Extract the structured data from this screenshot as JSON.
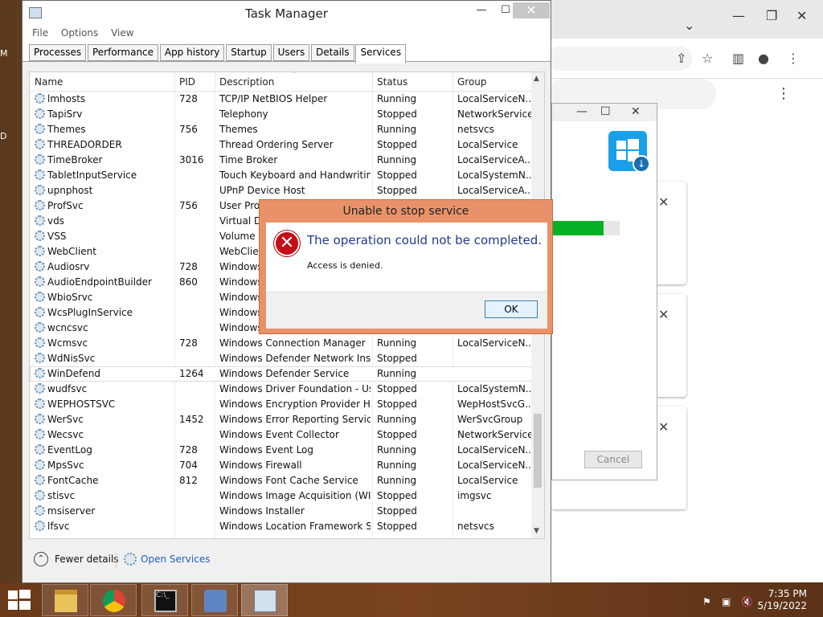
{
  "desktop": {
    "edge_labels": [
      "M",
      "D"
    ]
  },
  "taskmanager": {
    "title": "Task Manager",
    "menu": [
      "File",
      "Options",
      "View"
    ],
    "tabs": [
      "Processes",
      "Performance",
      "App history",
      "Startup",
      "Users",
      "Details",
      "Services"
    ],
    "active_tab": "Services",
    "columns": {
      "name": "Name",
      "pid": "PID",
      "description": "Description",
      "status": "Status",
      "group": "Group"
    },
    "rows": [
      {
        "name": "lmhosts",
        "pid": "728",
        "description": "TCP/IP NetBIOS Helper",
        "status": "Running",
        "group": "LocalServiceN..."
      },
      {
        "name": "TapiSrv",
        "pid": "",
        "description": "Telephony",
        "status": "Stopped",
        "group": "NetworkService"
      },
      {
        "name": "Themes",
        "pid": "756",
        "description": "Themes",
        "status": "Running",
        "group": "netsvcs"
      },
      {
        "name": "THREADORDER",
        "pid": "",
        "description": "Thread Ordering Server",
        "status": "Stopped",
        "group": "LocalService"
      },
      {
        "name": "TimeBroker",
        "pid": "3016",
        "description": "Time Broker",
        "status": "Running",
        "group": "LocalServiceA..."
      },
      {
        "name": "TabletInputService",
        "pid": "",
        "description": "Touch Keyboard and Handwritin...",
        "status": "Stopped",
        "group": "LocalSystemN..."
      },
      {
        "name": "upnphost",
        "pid": "",
        "description": "UPnP Device Host",
        "status": "Stopped",
        "group": "LocalServiceA..."
      },
      {
        "name": "ProfSvc",
        "pid": "756",
        "description": "User Profi",
        "status": "",
        "group": ""
      },
      {
        "name": "vds",
        "pid": "",
        "description": "Virtual Dis",
        "status": "",
        "group": ""
      },
      {
        "name": "VSS",
        "pid": "",
        "description": "Volume Sh",
        "status": "",
        "group": ""
      },
      {
        "name": "WebClient",
        "pid": "",
        "description": "WebClien",
        "status": "",
        "group": ""
      },
      {
        "name": "Audiosrv",
        "pid": "728",
        "description": "Windows",
        "status": "",
        "group": ""
      },
      {
        "name": "AudioEndpointBuilder",
        "pid": "860",
        "description": "Windows",
        "status": "",
        "group": ""
      },
      {
        "name": "WbioSrvc",
        "pid": "",
        "description": "Windows",
        "status": "",
        "group": ""
      },
      {
        "name": "WcsPlugInService",
        "pid": "",
        "description": "Windows",
        "status": "",
        "group": ""
      },
      {
        "name": "wcncsvc",
        "pid": "",
        "description": "Windows",
        "status": "",
        "group": ""
      },
      {
        "name": "Wcmsvc",
        "pid": "728",
        "description": "Windows Connection Manager",
        "status": "Running",
        "group": "LocalServiceN..."
      },
      {
        "name": "WdNisSvc",
        "pid": "",
        "description": "Windows Defender Network Insp...",
        "status": "Stopped",
        "group": ""
      },
      {
        "name": "WinDefend",
        "pid": "1264",
        "description": "Windows Defender Service",
        "status": "Running",
        "group": ""
      },
      {
        "name": "wudfsvc",
        "pid": "",
        "description": "Windows Driver Foundation - Us...",
        "status": "Stopped",
        "group": "LocalSystemN..."
      },
      {
        "name": "WEPHOSTSVC",
        "pid": "",
        "description": "Windows Encryption Provider H...",
        "status": "Stopped",
        "group": "WepHostSvcG..."
      },
      {
        "name": "WerSvc",
        "pid": "1452",
        "description": "Windows Error Reporting Service",
        "status": "Running",
        "group": "WerSvcGroup"
      },
      {
        "name": "Wecsvc",
        "pid": "",
        "description": "Windows Event Collector",
        "status": "Stopped",
        "group": "NetworkService"
      },
      {
        "name": "EventLog",
        "pid": "728",
        "description": "Windows Event Log",
        "status": "Running",
        "group": "LocalServiceN..."
      },
      {
        "name": "MpsSvc",
        "pid": "704",
        "description": "Windows Firewall",
        "status": "Running",
        "group": "LocalServiceN..."
      },
      {
        "name": "FontCache",
        "pid": "812",
        "description": "Windows Font Cache Service",
        "status": "Running",
        "group": "LocalService"
      },
      {
        "name": "stisvc",
        "pid": "",
        "description": "Windows Image Acquisition (WIA)",
        "status": "Stopped",
        "group": "imgsvc"
      },
      {
        "name": "msiserver",
        "pid": "",
        "description": "Windows Installer",
        "status": "Stopped",
        "group": ""
      },
      {
        "name": "lfsvc",
        "pid": "",
        "description": "Windows Location Framework S...",
        "status": "Stopped",
        "group": "netsvcs"
      }
    ],
    "selected_row": "WinDefend",
    "footer": {
      "fewer_details": "Fewer details",
      "open_services": "Open Services"
    }
  },
  "error_dialog": {
    "title": "Unable to stop service",
    "message": "The operation could not be completed.",
    "detail": "Access is denied.",
    "ok_label": "OK"
  },
  "installer": {
    "cancel_label": "Cancel",
    "progress_fraction": 0.76
  },
  "taskbar": {
    "time": "7:35 PM",
    "date": "5/19/2022",
    "apps": [
      "file-explorer-icon",
      "chrome-icon",
      "command-prompt-icon",
      "network-setup-icon",
      "task-manager-icon"
    ]
  },
  "colors": {
    "error_titlebar": "#e9926a",
    "link": "#1f5fbf",
    "progress": "#06b025"
  }
}
